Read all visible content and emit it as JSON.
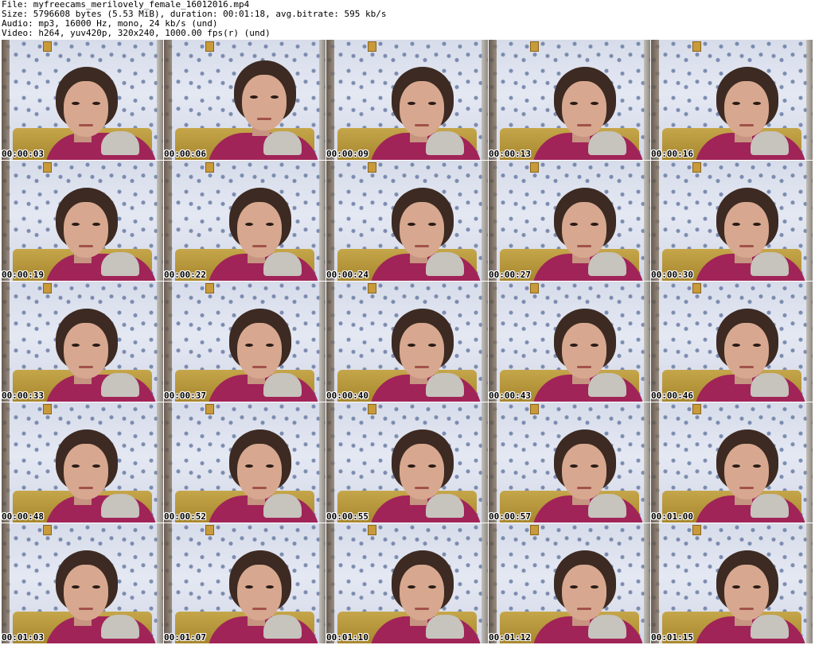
{
  "header": {
    "file_line": "File: myfreecams_merilovely_female_16012016.mp4",
    "size_line": "Size: 5796608 bytes (5.53 MiB), duration: 00:01:18, avg.bitrate: 595 kb/s",
    "audio_line": "Audio: mp3, 16000 Hz, mono, 24 kb/s (und)",
    "video_line": "Video: h264, yuv420p, 320x240, 1000.00 fps(r) (und)"
  },
  "thumbnails": [
    {
      "timestamp": "00:00:03"
    },
    {
      "timestamp": "00:00:06"
    },
    {
      "timestamp": "00:00:09"
    },
    {
      "timestamp": "00:00:13"
    },
    {
      "timestamp": "00:00:16"
    },
    {
      "timestamp": "00:00:19"
    },
    {
      "timestamp": "00:00:22"
    },
    {
      "timestamp": "00:00:24"
    },
    {
      "timestamp": "00:00:27"
    },
    {
      "timestamp": "00:00:30"
    },
    {
      "timestamp": "00:00:33"
    },
    {
      "timestamp": "00:00:37"
    },
    {
      "timestamp": "00:00:40"
    },
    {
      "timestamp": "00:00:43"
    },
    {
      "timestamp": "00:00:46"
    },
    {
      "timestamp": "00:00:48"
    },
    {
      "timestamp": "00:00:52"
    },
    {
      "timestamp": "00:00:55"
    },
    {
      "timestamp": "00:00:57"
    },
    {
      "timestamp": "00:01:00"
    },
    {
      "timestamp": "00:01:03"
    },
    {
      "timestamp": "00:01:07"
    },
    {
      "timestamp": "00:01:10"
    },
    {
      "timestamp": "00:01:12"
    },
    {
      "timestamp": "00:01:15"
    }
  ]
}
